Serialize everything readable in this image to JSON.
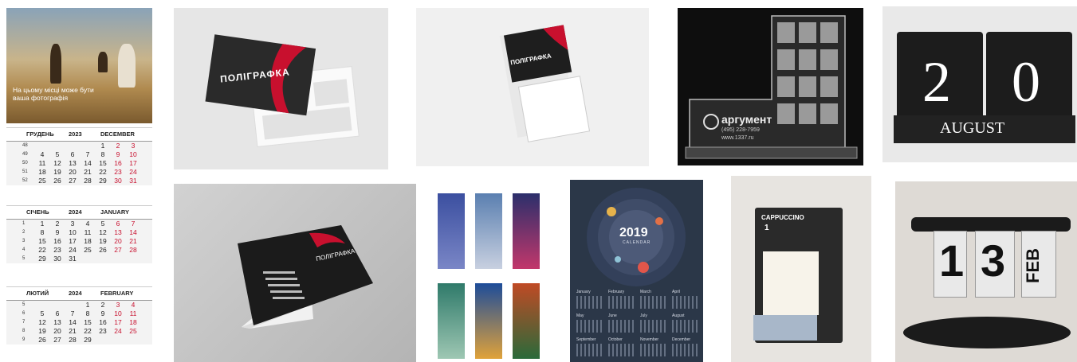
{
  "tiles": {
    "wall_calendar": {
      "promo_text": "На цьому місці може бути ваша фотографія",
      "months": [
        {
          "ua": "ГРУДЕНЬ",
          "year": "2023",
          "en": "DECEMBER",
          "rows": [
            {
              "wk": "48",
              "days": [
                "",
                "",
                "",
                "",
                "1",
                "2",
                "3"
              ]
            },
            {
              "wk": "49",
              "days": [
                "4",
                "5",
                "6",
                "7",
                "8",
                "9",
                "10"
              ]
            },
            {
              "wk": "50",
              "days": [
                "11",
                "12",
                "13",
                "14",
                "15",
                "16",
                "17"
              ]
            },
            {
              "wk": "51",
              "days": [
                "18",
                "19",
                "20",
                "21",
                "22",
                "23",
                "24"
              ]
            },
            {
              "wk": "52",
              "days": [
                "25",
                "26",
                "27",
                "28",
                "29",
                "30",
                "31"
              ]
            }
          ]
        },
        {
          "ua": "СІЧЕНЬ",
          "year": "2024",
          "en": "JANUARY",
          "rows": [
            {
              "wk": "1",
              "days": [
                "1",
                "2",
                "3",
                "4",
                "5",
                "6",
                "7"
              ]
            },
            {
              "wk": "2",
              "days": [
                "8",
                "9",
                "10",
                "11",
                "12",
                "13",
                "14"
              ]
            },
            {
              "wk": "3",
              "days": [
                "15",
                "16",
                "17",
                "18",
                "19",
                "20",
                "21"
              ]
            },
            {
              "wk": "4",
              "days": [
                "22",
                "23",
                "24",
                "25",
                "26",
                "27",
                "28"
              ]
            },
            {
              "wk": "5",
              "days": [
                "29",
                "30",
                "31",
                "",
                "",
                "",
                ""
              ]
            }
          ]
        },
        {
          "ua": "ЛЮТИЙ",
          "year": "2024",
          "en": "FEBRUARY",
          "rows": [
            {
              "wk": "5",
              "days": [
                "",
                "",
                "",
                "1",
                "2",
                "3",
                "4"
              ]
            },
            {
              "wk": "6",
              "days": [
                "5",
                "6",
                "7",
                "8",
                "9",
                "10",
                "11"
              ]
            },
            {
              "wk": "7",
              "days": [
                "12",
                "13",
                "14",
                "15",
                "16",
                "17",
                "18"
              ]
            },
            {
              "wk": "8",
              "days": [
                "19",
                "20",
                "21",
                "22",
                "23",
                "24",
                "25"
              ]
            },
            {
              "wk": "9",
              "days": [
                "26",
                "27",
                "28",
                "29",
                "",
                "",
                ""
              ]
            }
          ]
        }
      ]
    },
    "business_card": {
      "brand": "ПОЛІГРАФКА"
    },
    "hanging_calendar": {
      "brand": "ПОЛІГРАФКА"
    },
    "acrylic_calendar": {
      "brand": "аргумент",
      "phone": "(495) 228-7959",
      "site": "www.1337.ru"
    },
    "block_calendar": {
      "day_left": "2",
      "day_right": "0",
      "month": "AUGUST"
    },
    "desk_calendar": {
      "brand": "ПОЛІГРАФКА"
    },
    "space_calendar": {
      "year": "2019",
      "caption": "CALENDAR",
      "months": [
        "January",
        "February",
        "March",
        "April",
        "May",
        "June",
        "July",
        "August",
        "September",
        "October",
        "November",
        "December"
      ]
    },
    "box_calendar": {
      "label": "CAPPUCCINO",
      "number": "1"
    },
    "flip_calendar": {
      "day_tens": "1",
      "day_ones": "3",
      "month": "FEB"
    }
  },
  "colors": {
    "accent_red": "#c8102e",
    "dark": "#1a1a1a",
    "navy": "#2b3748"
  }
}
